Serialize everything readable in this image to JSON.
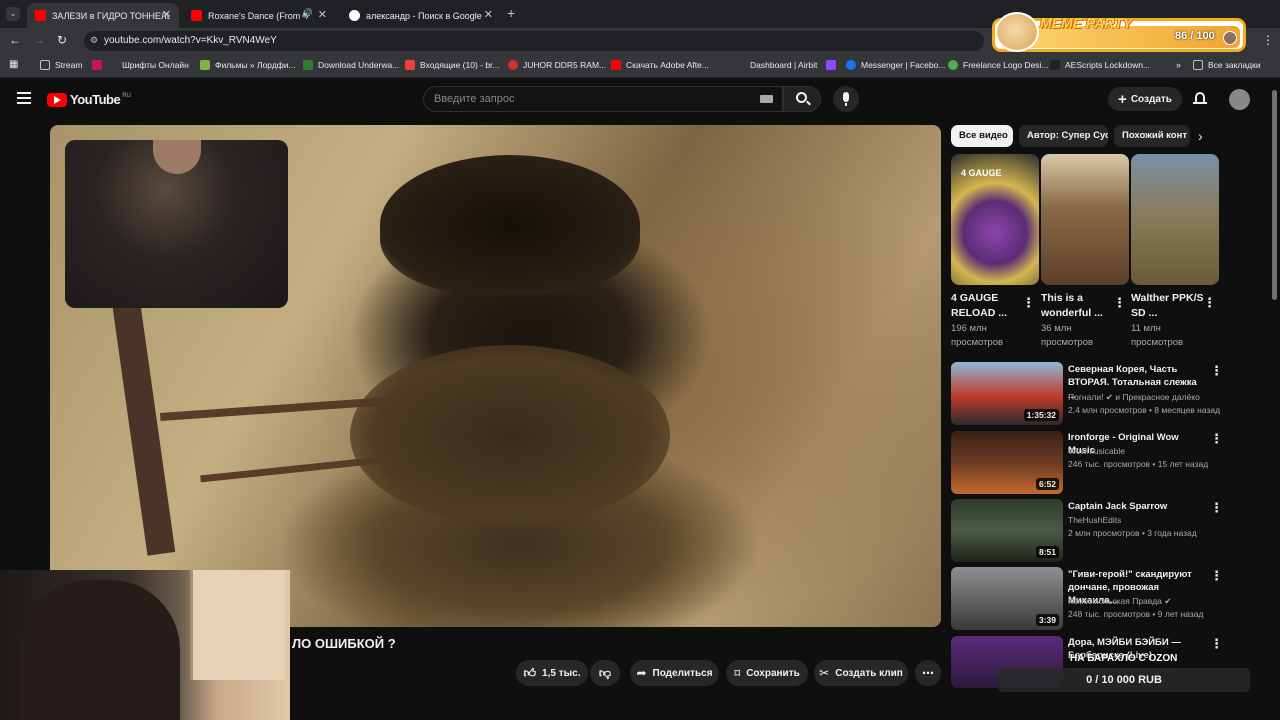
{
  "browser": {
    "tabs": [
      {
        "label": "ЗАЛЕЗИ в ГИДРО ТОННЕЛЬ!",
        "active": true
      },
      {
        "label": "Roxane's Dance (From \"Ale",
        "active": false
      },
      {
        "label": "александр - Поиск в Google",
        "active": false
      }
    ],
    "new_tab": "+",
    "url": "youtube.com/watch?v=Kkv_RVN4WeY",
    "bookmarks": [
      "Stream",
      "Шрифты Онлайн",
      "Фильмы » Лордфи...",
      "Download Underwa...",
      "Входящие (10) - br...",
      "JUHOR DDR5 RAM...",
      "Скачать Adobe Afte...",
      "Dashboard | Airbit",
      "Messenger | Facebo...",
      "Freelance Logo Desi...",
      "AEScripts Lockdown...",
      "Все закладки"
    ]
  },
  "overlay": {
    "meme_title": "MEME PARTY",
    "meme_count": "86 / 100",
    "donation": "0 / 10 000 RUB"
  },
  "youtube": {
    "logo": "YouTube",
    "logo_region": "RU",
    "search_placeholder": "Введите запрос",
    "create_label": "Создать",
    "video_title": "ЛО ОШИБКОЙ ?",
    "actions": {
      "likes": "1,5 тыс.",
      "share": "Поделиться",
      "save": "Сохранить",
      "clip": "Создать клип"
    },
    "chips": [
      "Все видео",
      "Автор: Супер Сус",
      "Похожий конт"
    ],
    "shorts": [
      {
        "title": "4 GAUGE RELOAD ...",
        "views": "196 млн просмотров"
      },
      {
        "title": "This is a wonderful ...",
        "views": "36 млн просмотров"
      },
      {
        "title": "Walther PPK/S SD ...",
        "views": "11 млн просмотров"
      }
    ],
    "recommended": [
      {
        "title": "Северная Корея, Часть ВТОРАЯ. Тотальная слежка ...",
        "channel": "Погнали! ✔ и Прекрасное далёко",
        "meta": "2,4 млн просмотров • 8 месяцев назад",
        "duration": "1:35:32"
      },
      {
        "title": "Ironforge - Original Wow Music",
        "channel": "Wowmusicable",
        "meta": "246 тыс. просмотров • 15 лет назад",
        "duration": "6:52"
      },
      {
        "title": "Captain Jack Sparrow",
        "channel": "TheHushEdits",
        "meta": "2 млн просмотров • 3 года назад",
        "duration": "8:51"
      },
      {
        "title": "\"Гиви-герой!\" скандируют дончане, провожая Михаила...",
        "channel": "Комсомольская Правда ✔",
        "meta": "248 тыс. просмотров • 9 лет назад",
        "duration": "3:39"
      },
      {
        "title": "Дора, МЭЙБИ БЭЙБИ — Барбариска (Live)",
        "channel": "",
        "meta": "",
        "duration": ""
      }
    ],
    "ozon_text": "НА БАРАХЛО С OZON"
  }
}
